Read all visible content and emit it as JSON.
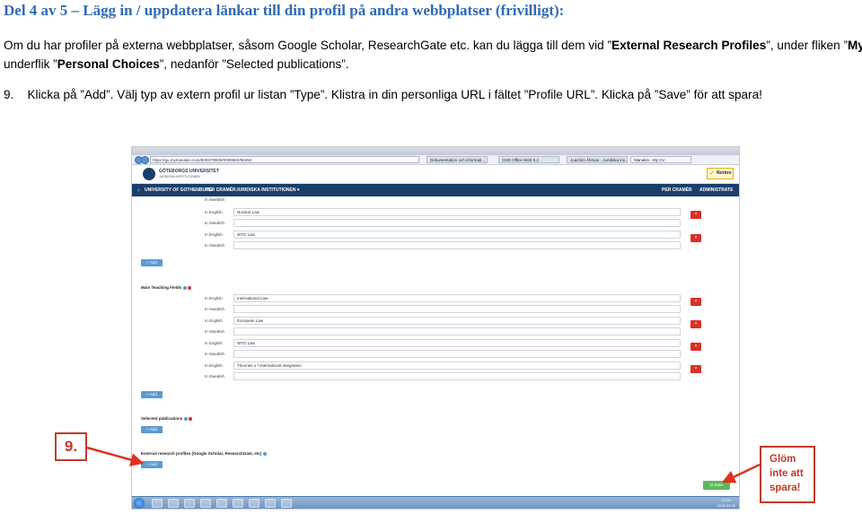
{
  "doc": {
    "heading": "Del 4 av 5 – Lägg in / uppdatera länkar till din profil på andra webbplatser (frivilligt):",
    "para1_line1_a": "Om du har profiler på externa webbplatser, såsom Google Scholar, ResearchGate etc. kan du lägga till dem vid ”",
    "para1_line1_b": "External Research Profiles",
    "para1_line1_c": "”, under fliken ”",
    "para1_line1_d": "My CV",
    "para1_line1_e": "”,",
    "para1_line2_a": "underflik ”",
    "para1_line2_b": "Personal Choices",
    "para1_line2_c": "”, nedanför ”Selected publications”.",
    "step_number": "9.",
    "step_text": "Klicka på ”Add”. Välj typ av extern profil ur listan ”Type”. Klistra in din personliga URL i fältet ”Profile URL”. Klicka på ”Save” för att spara!"
  },
  "screenshot": {
    "address": "https://gu.mymanakin.com/5003/78508/2005582/56250",
    "tabs": [
      "Dokumentation och informati...",
      "CMS Office Web 8.2",
      "Joachim Åhman - Juridiska ins...",
      "Manakin - My CV"
    ],
    "university_name": "GÖTEBORGS UNIVERSITET",
    "university_sub": "JURIDISKA INSTITUTIONEN",
    "norton_label": "Norton",
    "nav": {
      "home": "UNIVERSITY OF GOTHENBURG",
      "user": "PER CRAMÉR",
      "department": "JURIDISKA INSTITUTIONEN ▾",
      "user_right": "PER CRAMÉR",
      "admin": "ADMINISTRATE"
    },
    "top_rows": [
      {
        "label": "In Swedish",
        "value": ""
      },
      {
        "label": "In English",
        "value": "Nuclear Law"
      },
      {
        "label": "In Swedish",
        "value": ""
      },
      {
        "label": "In English",
        "value": "WTO Law"
      },
      {
        "label": "In Swedish",
        "value": ""
      }
    ],
    "add_label": "+ Add",
    "teaching_title": "Main Teaching Fields",
    "teaching_rows": [
      {
        "label": "In English",
        "value": "International Law"
      },
      {
        "label": "In Swedish",
        "value": ""
      },
      {
        "label": "In English",
        "value": "European Law"
      },
      {
        "label": "In Swedish",
        "value": ""
      },
      {
        "label": "In English",
        "value": "WTO Law"
      },
      {
        "label": "In Swedish",
        "value": ""
      },
      {
        "label": "In English",
        "value": "Theories o f international integration"
      },
      {
        "label": "In Swedish",
        "value": ""
      }
    ],
    "delete_symbol": "×",
    "selected_pubs_title": "Selected publications",
    "external_title": "External research profiles (Google Scholar, ResearchGate, etc)",
    "save_label": "Save",
    "clock_time": "12:06",
    "clock_date": "2018-03-28"
  },
  "annotations": {
    "step_label": "9.",
    "reminder_line1": "Glöm",
    "reminder_line2": "inte att",
    "reminder_line3": "spara!",
    "color": "#c0392b"
  }
}
